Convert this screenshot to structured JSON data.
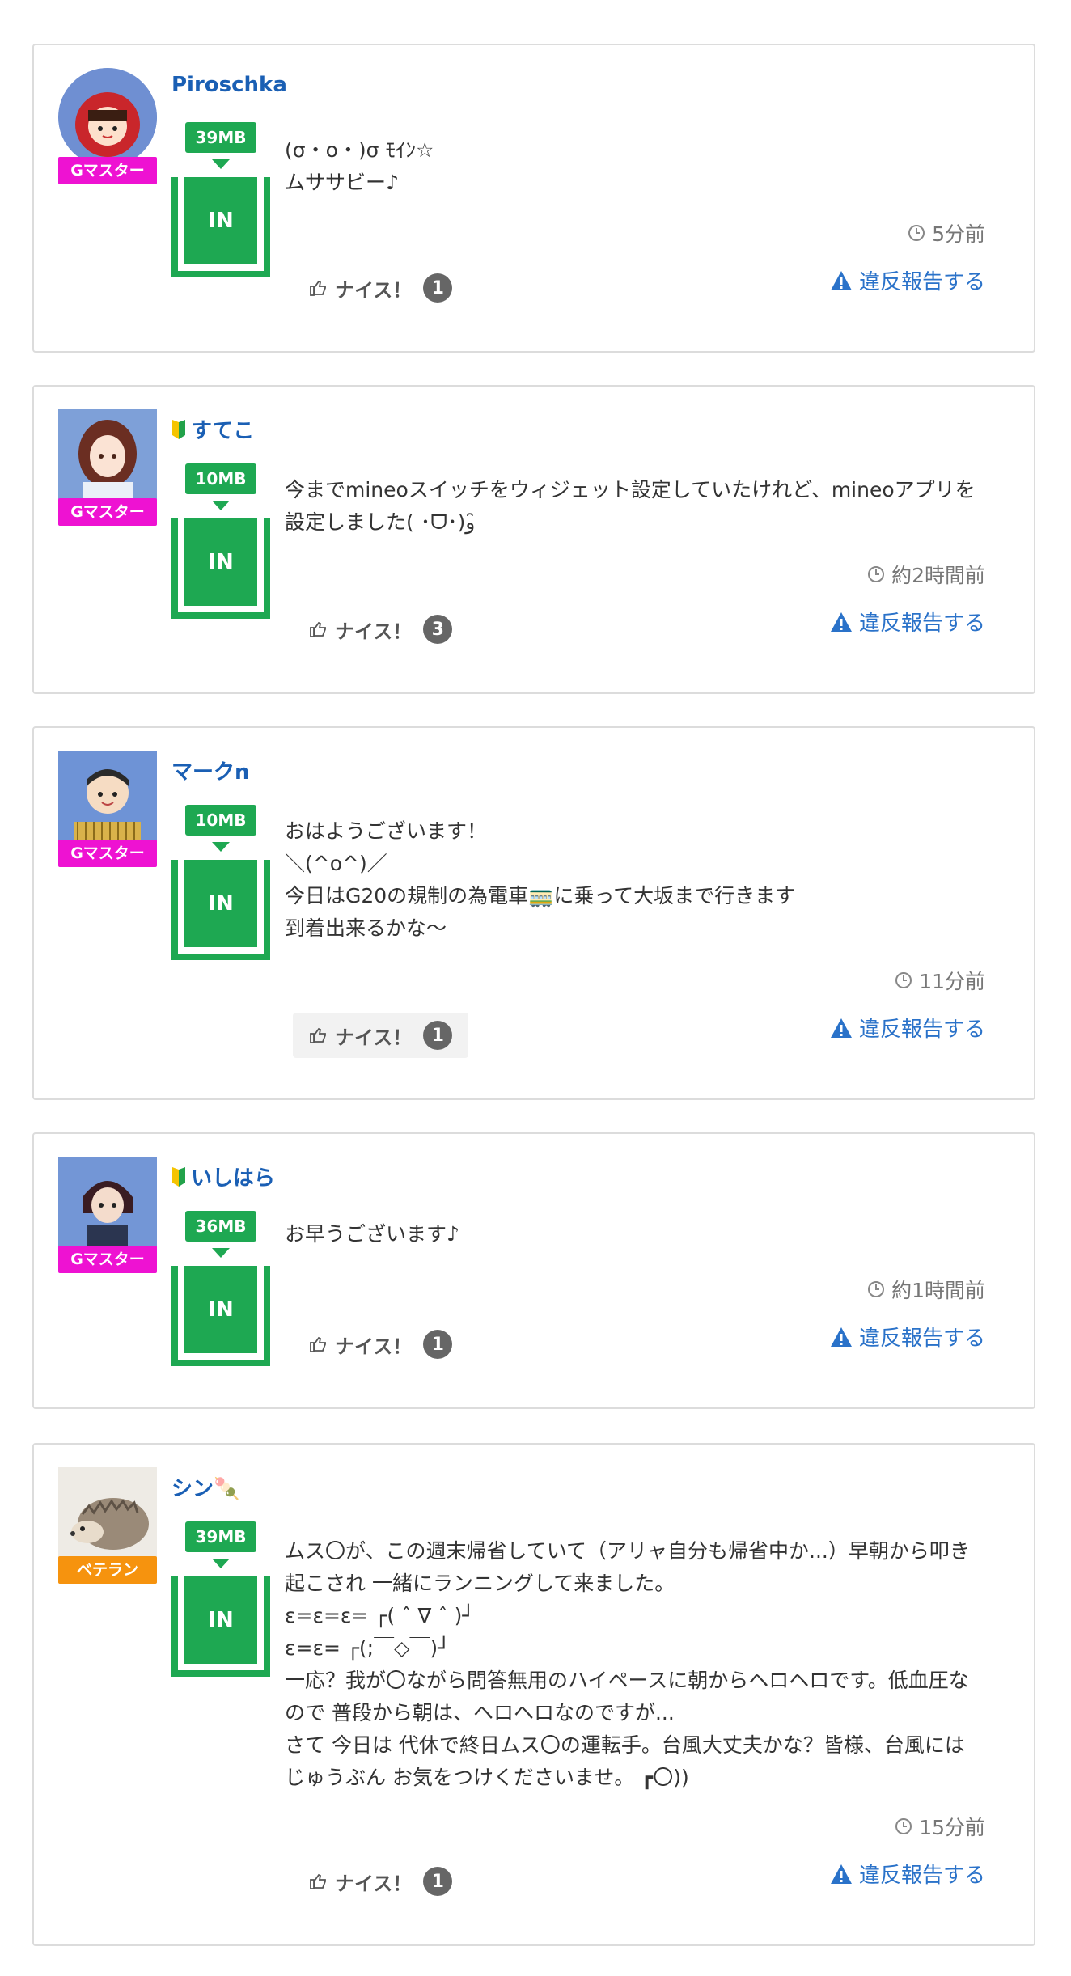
{
  "posts": [
    {
      "name": "Piroschka",
      "beginner": false,
      "badge": "Gマスター",
      "mb": "39MB",
      "in_label": "IN",
      "lines": [
        "(σ・o・)σ ﾓｲﾝ☆",
        "ムササビー♪"
      ],
      "time": "5分前",
      "nice_label": "ナイス！",
      "nice_count": "1",
      "report_label": "違反報告する"
    },
    {
      "name": "すてこ",
      "beginner": true,
      "badge": "Gマスター",
      "mb": "10MB",
      "in_label": "IN",
      "lines": [
        "今までmineoスイッチをウィジェット設定していたけれど、mineoアプリを設定しました( ･ᗜ･)و ̑̑"
      ],
      "time": "約2時間前",
      "nice_label": "ナイス！",
      "nice_count": "3",
      "report_label": "違反報告する"
    },
    {
      "name": "マークn",
      "beginner": false,
      "badge": "Gマスター",
      "mb": "10MB",
      "in_label": "IN",
      "lines": [
        "おはようございます！",
        "＼(^o^)／",
        "今日はG20の規制の為電車🚃に乗って大坂まで行きます",
        "到着出来るかな〜"
      ],
      "time": "11分前",
      "nice_label": "ナイス！",
      "nice_count": "1",
      "report_label": "違反報告する"
    },
    {
      "name": "いしはら",
      "beginner": true,
      "badge": "Gマスター",
      "mb": "36MB",
      "in_label": "IN",
      "lines": [
        "お早うございます♪"
      ],
      "time": "約1時間前",
      "nice_label": "ナイス！",
      "nice_count": "1",
      "report_label": "違反報告する"
    },
    {
      "name": "シン🍡",
      "beginner": false,
      "badge": "ベテラン",
      "mb": "39MB",
      "in_label": "IN",
      "lines": [
        "ムス〇が、この週末帰省していて（アリャ自分も帰省中か...）早朝から叩き起こされ 一緒にランニングして来ました。",
        "ε=ε=ε= ┌( ˆ ∇ ˆ )┘",
        "ε=ε= ┌(;￣◇￣)┘",
        "一応？我が〇ながら問答無用のハイペースに朝からヘロヘロです。低血圧なので 普段から朝は、ヘロヘロなのですが...",
        "さて 今日は 代休で終日ムス〇の運転手。台風大丈夫かな？皆様、台風には じゅうぶん お気をつけくださいませ。 ┏〇))"
      ],
      "time": "15分前",
      "nice_label": "ナイス！",
      "nice_count": "1",
      "report_label": "違反報告する"
    }
  ],
  "colors": {
    "brand_green": "#1ea852",
    "badge_master": "#ee12d2",
    "badge_veteran": "#f6930e",
    "link_blue": "#1a5fb4",
    "report_blue": "#2a72c9"
  }
}
